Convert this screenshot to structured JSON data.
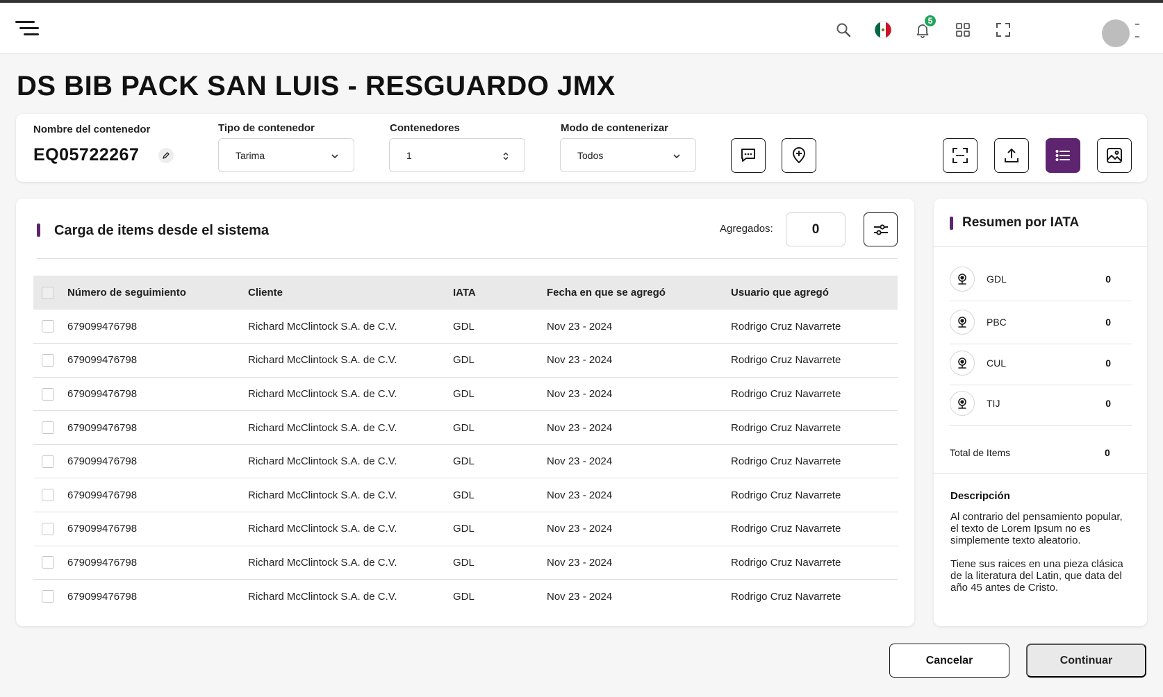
{
  "header": {
    "notification_count": "5"
  },
  "page": {
    "title": "DS BIB PACK SAN LUIS - RESGUARDO JMX"
  },
  "container_form": {
    "name_label": "Nombre del contenedor",
    "name_value": "EQ05722267",
    "type_label": "Tipo de contenedor",
    "type_value": "Tarima",
    "count_label": "Contenedores",
    "count_value": "1",
    "mode_label": "Modo de contenerizar",
    "mode_value": "Todos"
  },
  "items_section": {
    "title": "Carga de items desde el sistema",
    "added_label": "Agregados:",
    "added_value": "0",
    "columns": [
      "Número de seguimiento",
      "Cliente",
      "IATA",
      "Fecha en que se agregó",
      "Usuario que agregó"
    ],
    "rows": [
      [
        "679099476798",
        "Richard McClintock S.A. de C.V.",
        "GDL",
        "Nov 23 - 2024",
        "Rodrigo Cruz Navarrete"
      ],
      [
        "679099476798",
        "Richard McClintock S.A. de C.V.",
        "GDL",
        "Nov 23 - 2024",
        "Rodrigo Cruz Navarrete"
      ],
      [
        "679099476798",
        "Richard McClintock S.A. de C.V.",
        "GDL",
        "Nov 23 - 2024",
        "Rodrigo Cruz Navarrete"
      ],
      [
        "679099476798",
        "Richard McClintock S.A. de C.V.",
        "GDL",
        "Nov 23 - 2024",
        "Rodrigo Cruz Navarrete"
      ],
      [
        "679099476798",
        "Richard McClintock S.A. de C.V.",
        "GDL",
        "Nov 23 - 2024",
        "Rodrigo Cruz Navarrete"
      ],
      [
        "679099476798",
        "Richard McClintock S.A. de C.V.",
        "GDL",
        "Nov 23 - 2024",
        "Rodrigo Cruz Navarrete"
      ],
      [
        "679099476798",
        "Richard McClintock S.A. de C.V.",
        "GDL",
        "Nov 23 - 2024",
        "Rodrigo Cruz Navarrete"
      ],
      [
        "679099476798",
        "Richard McClintock S.A. de C.V.",
        "GDL",
        "Nov 23 - 2024",
        "Rodrigo Cruz Navarrete"
      ],
      [
        "679099476798",
        "Richard McClintock S.A. de C.V.",
        "GDL",
        "Nov 23 - 2024",
        "Rodrigo Cruz Navarrete"
      ]
    ]
  },
  "iata_summary": {
    "title": "Resumen por IATA",
    "rows": [
      {
        "code": "GDL",
        "count": "0"
      },
      {
        "code": "PBC",
        "count": "0"
      },
      {
        "code": "CUL",
        "count": "0"
      },
      {
        "code": "TIJ",
        "count": "0"
      }
    ],
    "total_label": "Total de Items",
    "total_value": "0",
    "description_title": "Descripción",
    "description_p1": "Al contrario del pensamiento popular, el texto de Lorem Ipsum no es simplemente texto aleatorio.",
    "description_p2": "Tiene sus raices en una pieza clásica de la literatura del Latin, que data del año 45 antes de Cristo."
  },
  "footer": {
    "cancel_label": "Cancelar",
    "continue_label": "Continuar"
  },
  "colors": {
    "accent": "#5f2470",
    "badge": "#22a45d"
  },
  "icons": [
    "menu-icon",
    "search-icon",
    "mexico-flag-icon",
    "bell-icon",
    "apps-grid-icon",
    "fullscreen-icon",
    "pencil-icon",
    "chevron-down-icon",
    "stepper-icon",
    "comment-icon",
    "add-location-icon",
    "scan-icon",
    "upload-icon",
    "list-icon",
    "image-icon",
    "filter-sliders-icon",
    "location-pin-icon"
  ]
}
